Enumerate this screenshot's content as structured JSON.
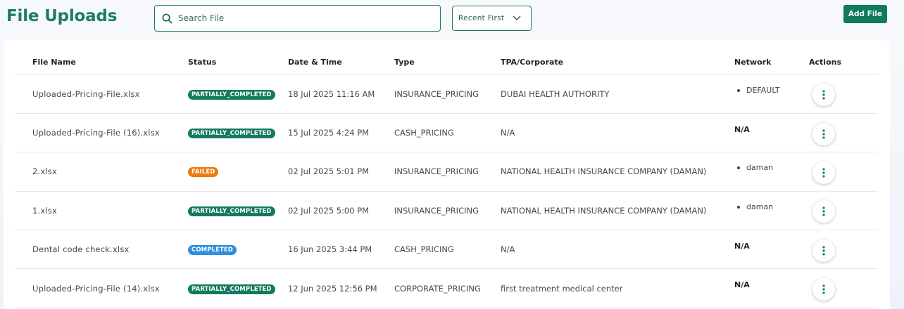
{
  "header": {
    "title": "File Uploads",
    "search_placeholder": "Search File",
    "search_value": "",
    "sort_selected": "Recent First",
    "add_button_label": "Add File"
  },
  "colors": {
    "accent": "#0f7a5e",
    "status_partially_completed": "#137a5f",
    "status_failed": "#e97d0c",
    "status_completed": "#2e8ee0"
  },
  "table": {
    "columns": [
      "File Name",
      "Status",
      "Date & Time",
      "Type",
      "TPA/Corporate",
      "Network",
      "Actions"
    ],
    "rows": [
      {
        "file_name": "Uploaded-Pricing-File.xlsx",
        "status": "PARTIALLY_COMPLETED",
        "status_color": "#137a5f",
        "datetime": "18 Jul 2025 11:16 AM",
        "type": "INSURANCE_PRICING",
        "tpa": "DUBAI HEALTH AUTHORITY",
        "network": [
          "DEFAULT"
        ],
        "network_na": "",
        "action_icon": "more-vertical-icon"
      },
      {
        "file_name": "Uploaded-Pricing-File (16).xlsx",
        "status": "PARTIALLY_COMPLETED",
        "status_color": "#137a5f",
        "datetime": "15 Jul 2025 4:24 PM",
        "type": "CASH_PRICING",
        "tpa": "N/A",
        "network": [],
        "network_na": "N/A",
        "action_icon": "more-vertical-icon"
      },
      {
        "file_name": "2.xlsx",
        "status": "FAILED",
        "status_color": "#e97d0c",
        "datetime": "02 Jul 2025 5:01 PM",
        "type": "INSURANCE_PRICING",
        "tpa": "NATIONAL HEALTH INSURANCE COMPANY (DAMAN)",
        "network": [
          "daman"
        ],
        "network_na": "",
        "action_icon": "more-vertical-icon"
      },
      {
        "file_name": "1.xlsx",
        "status": "PARTIALLY_COMPLETED",
        "status_color": "#137a5f",
        "datetime": "02 Jul 2025 5:00 PM",
        "type": "INSURANCE_PRICING",
        "tpa": "NATIONAL HEALTH INSURANCE COMPANY (DAMAN)",
        "network": [
          "daman"
        ],
        "network_na": "",
        "action_icon": "more-vertical-icon"
      },
      {
        "file_name": "Dental code check.xlsx",
        "status": "COMPLETED",
        "status_color": "#2e8ee0",
        "datetime": "16 Jun 2025 3:44 PM",
        "type": "CASH_PRICING",
        "tpa": "N/A",
        "network": [],
        "network_na": "N/A",
        "action_icon": "more-vertical-icon"
      },
      {
        "file_name": "Uploaded-Pricing-File (14).xlsx",
        "status": "PARTIALLY_COMPLETED",
        "status_color": "#137a5f",
        "datetime": "12 Jun 2025 12:56 PM",
        "type": "CORPORATE_PRICING",
        "tpa": "first treatment medical center",
        "network": [],
        "network_na": "N/A",
        "action_icon": "more-vertical-icon"
      }
    ]
  }
}
